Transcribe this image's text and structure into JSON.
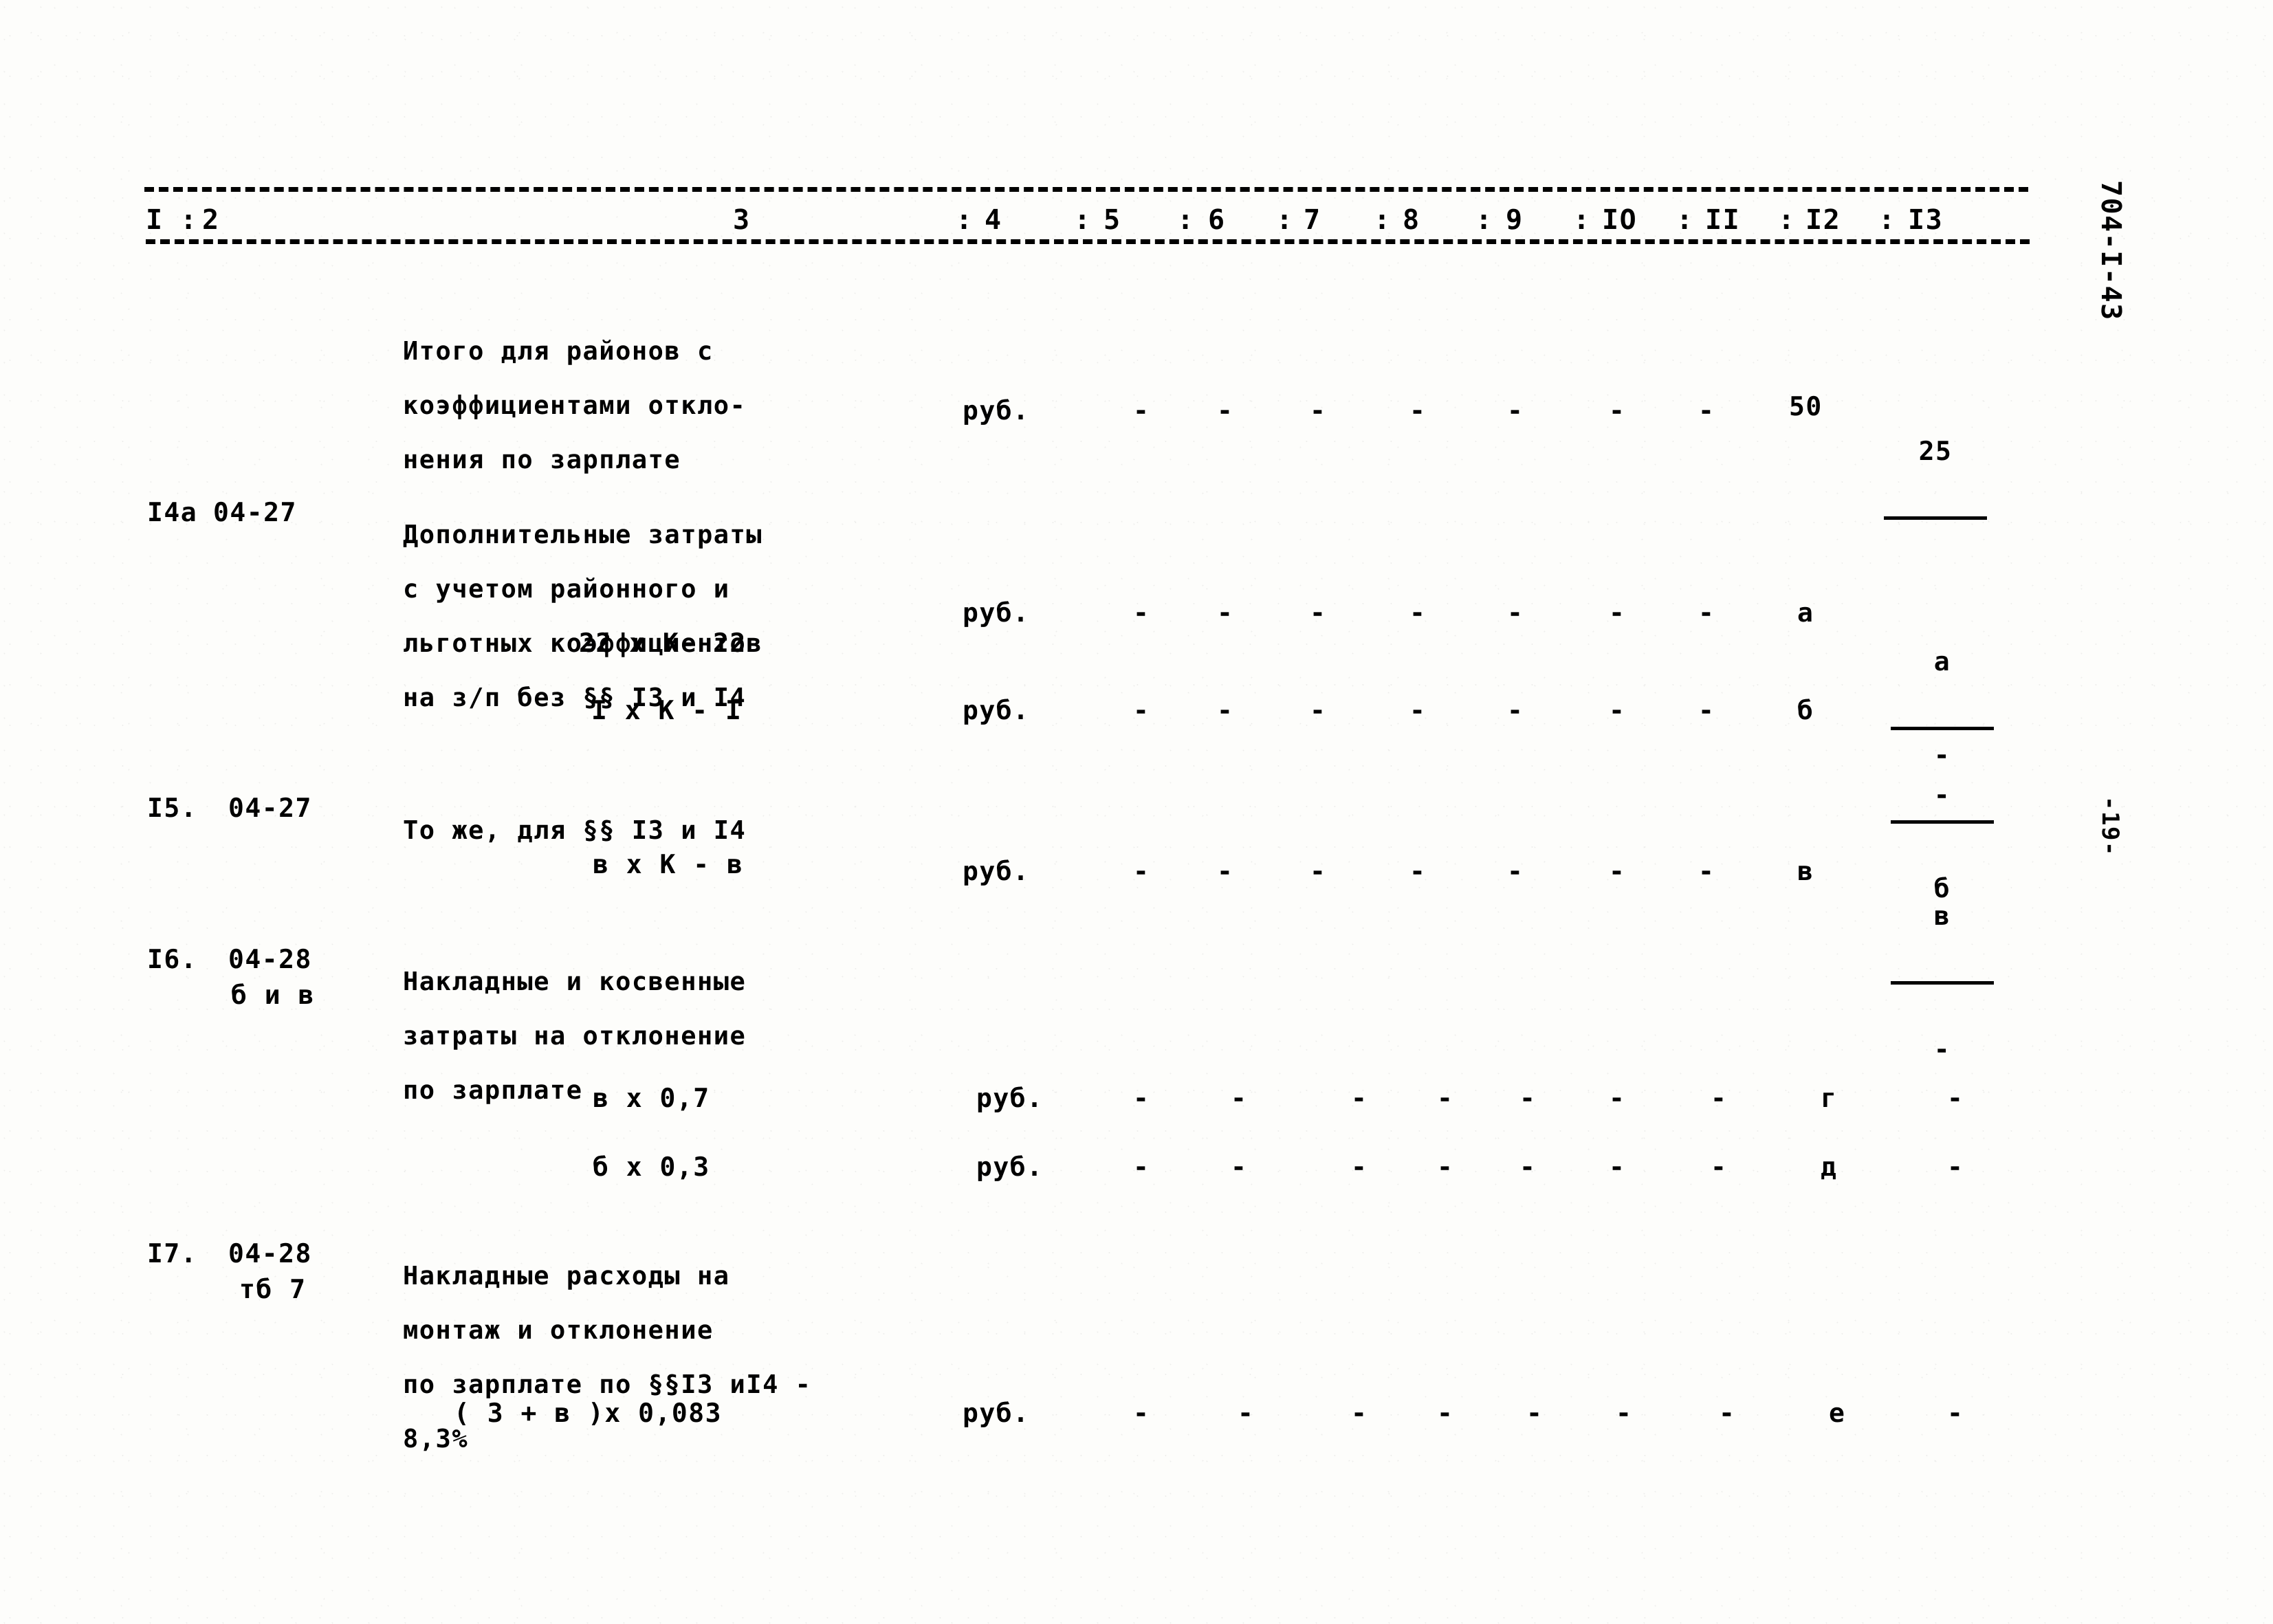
{
  "document": {
    "sheet_code": "704-I-43",
    "page_number": "-19-",
    "unit_label": "руб."
  },
  "table": {
    "column_headers": [
      "I",
      "2",
      "3",
      "4",
      "5",
      "6",
      "7",
      "8",
      "9",
      "IО",
      "II",
      "I2",
      "I3"
    ],
    "rows": [
      {
        "id": "row-total-regional",
        "number": "",
        "code": "",
        "description": [
          "Итого для районов с",
          "коэффициентами откло-",
          "нения по зарплате"
        ],
        "unit": "руб.",
        "dashes": [
          "-",
          "-",
          "-",
          "-",
          "-",
          "-",
          "-"
        ],
        "col12": "50",
        "col13_fraction": {
          "top": "25",
          "bar": true,
          "bot": ""
        }
      },
      {
        "id": "row-14a",
        "number": "I4a",
        "code": "04-27",
        "description": [
          "Дополнительные затраты",
          "с учетом районного и",
          "льготных коэффициентов",
          "на з/п без §§ I3 и I4"
        ],
        "formulas": [
          {
            "id": "formula-22k22",
            "text": "22 х К- 22",
            "unit": "руб.",
            "dashes": [
              "-",
              "-",
              "-",
              "-",
              "-",
              "-",
              "-"
            ],
            "col12": "а",
            "col13_fraction": {
              "top": "а",
              "bar": true,
              "bot": "-"
            }
          },
          {
            "id": "formula-1k1",
            "text": "I х К - I",
            "unit": "руб.",
            "dashes": [
              "-",
              "-",
              "-",
              "-",
              "-",
              "-",
              "-"
            ],
            "col12": "б",
            "col13_fraction": {
              "top": "-",
              "bar": true,
              "bot": "б"
            }
          }
        ]
      },
      {
        "id": "row-15",
        "number": "I5.",
        "code": "04-27",
        "description": [
          "То же, для §§ I3 и I4"
        ],
        "formulas": [
          {
            "id": "formula-vkv",
            "text": "в х К - в",
            "unit": "руб.",
            "dashes": [
              "-",
              "-",
              "-",
              "-",
              "-",
              "-",
              "-"
            ],
            "col12": "в",
            "col13_fraction": {
              "top": "в",
              "bar": true,
              "bot": "-"
            }
          }
        ]
      },
      {
        "id": "row-16",
        "number": "I6.",
        "code": "04-28",
        "code_sub": "б и в",
        "description": [
          "Накладные и косвенные",
          "затраты на отклонение",
          "по зарплате"
        ],
        "formulas": [
          {
            "id": "formula-v07",
            "text": "в х 0,7",
            "unit": "руб.",
            "dashes": [
              "-",
              "-",
              "-",
              "-",
              "-",
              "-",
              "-"
            ],
            "col12": "г",
            "col13": "-"
          },
          {
            "id": "formula-b03",
            "text": "б х 0,3",
            "unit": "руб.",
            "dashes": [
              "-",
              "-",
              "-",
              "-",
              "-",
              "-",
              "-"
            ],
            "col12": "д",
            "col13": "-"
          }
        ]
      },
      {
        "id": "row-17",
        "number": "I7.",
        "code": "04-28",
        "code_sub": "тб 7",
        "description": [
          "Накладные расходы на",
          "монтаж и отклонение",
          "по зарплате по §§I3 иI4 -",
          "8,3%"
        ],
        "formulas": [
          {
            "id": "formula-3v0083",
            "text": "( 3 + в )х 0,083",
            "unit": "руб.",
            "dashes": [
              "-",
              "-",
              "-",
              "-",
              "-",
              "-",
              "-"
            ],
            "col12": "е",
            "col13": "-"
          }
        ]
      }
    ]
  }
}
